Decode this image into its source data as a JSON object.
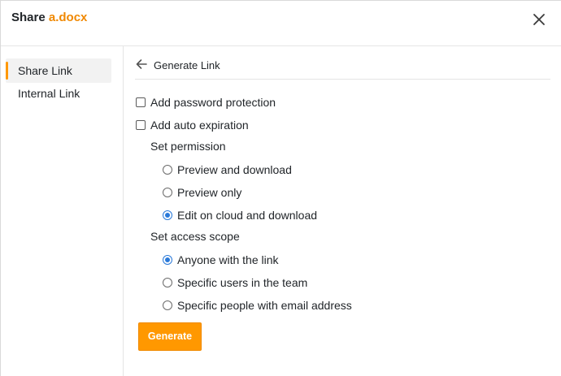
{
  "dialog": {
    "title_prefix": "Share",
    "file_name": "a.docx"
  },
  "sidebar": {
    "items": [
      {
        "label": "Share Link",
        "active": true
      },
      {
        "label": "Internal Link",
        "active": false
      }
    ]
  },
  "content": {
    "subheader_title": "Generate Link",
    "options": {
      "password_protection": {
        "label": "Add password protection",
        "checked": false
      },
      "auto_expiration": {
        "label": "Add auto expiration",
        "checked": false
      }
    },
    "permission": {
      "label": "Set permission",
      "choices": [
        {
          "label": "Preview and download",
          "selected": false
        },
        {
          "label": "Preview only",
          "selected": false
        },
        {
          "label": "Edit on cloud and download",
          "selected": true
        }
      ]
    },
    "access_scope": {
      "label": "Set access scope",
      "choices": [
        {
          "label": "Anyone with the link",
          "selected": true
        },
        {
          "label": "Specific users in the team",
          "selected": false
        },
        {
          "label": "Specific people with email address",
          "selected": false
        }
      ]
    },
    "generate_label": "Generate"
  },
  "colors": {
    "accent": "#ff9800",
    "file_name": "#f08800",
    "radio_selected": "#2979d9"
  }
}
